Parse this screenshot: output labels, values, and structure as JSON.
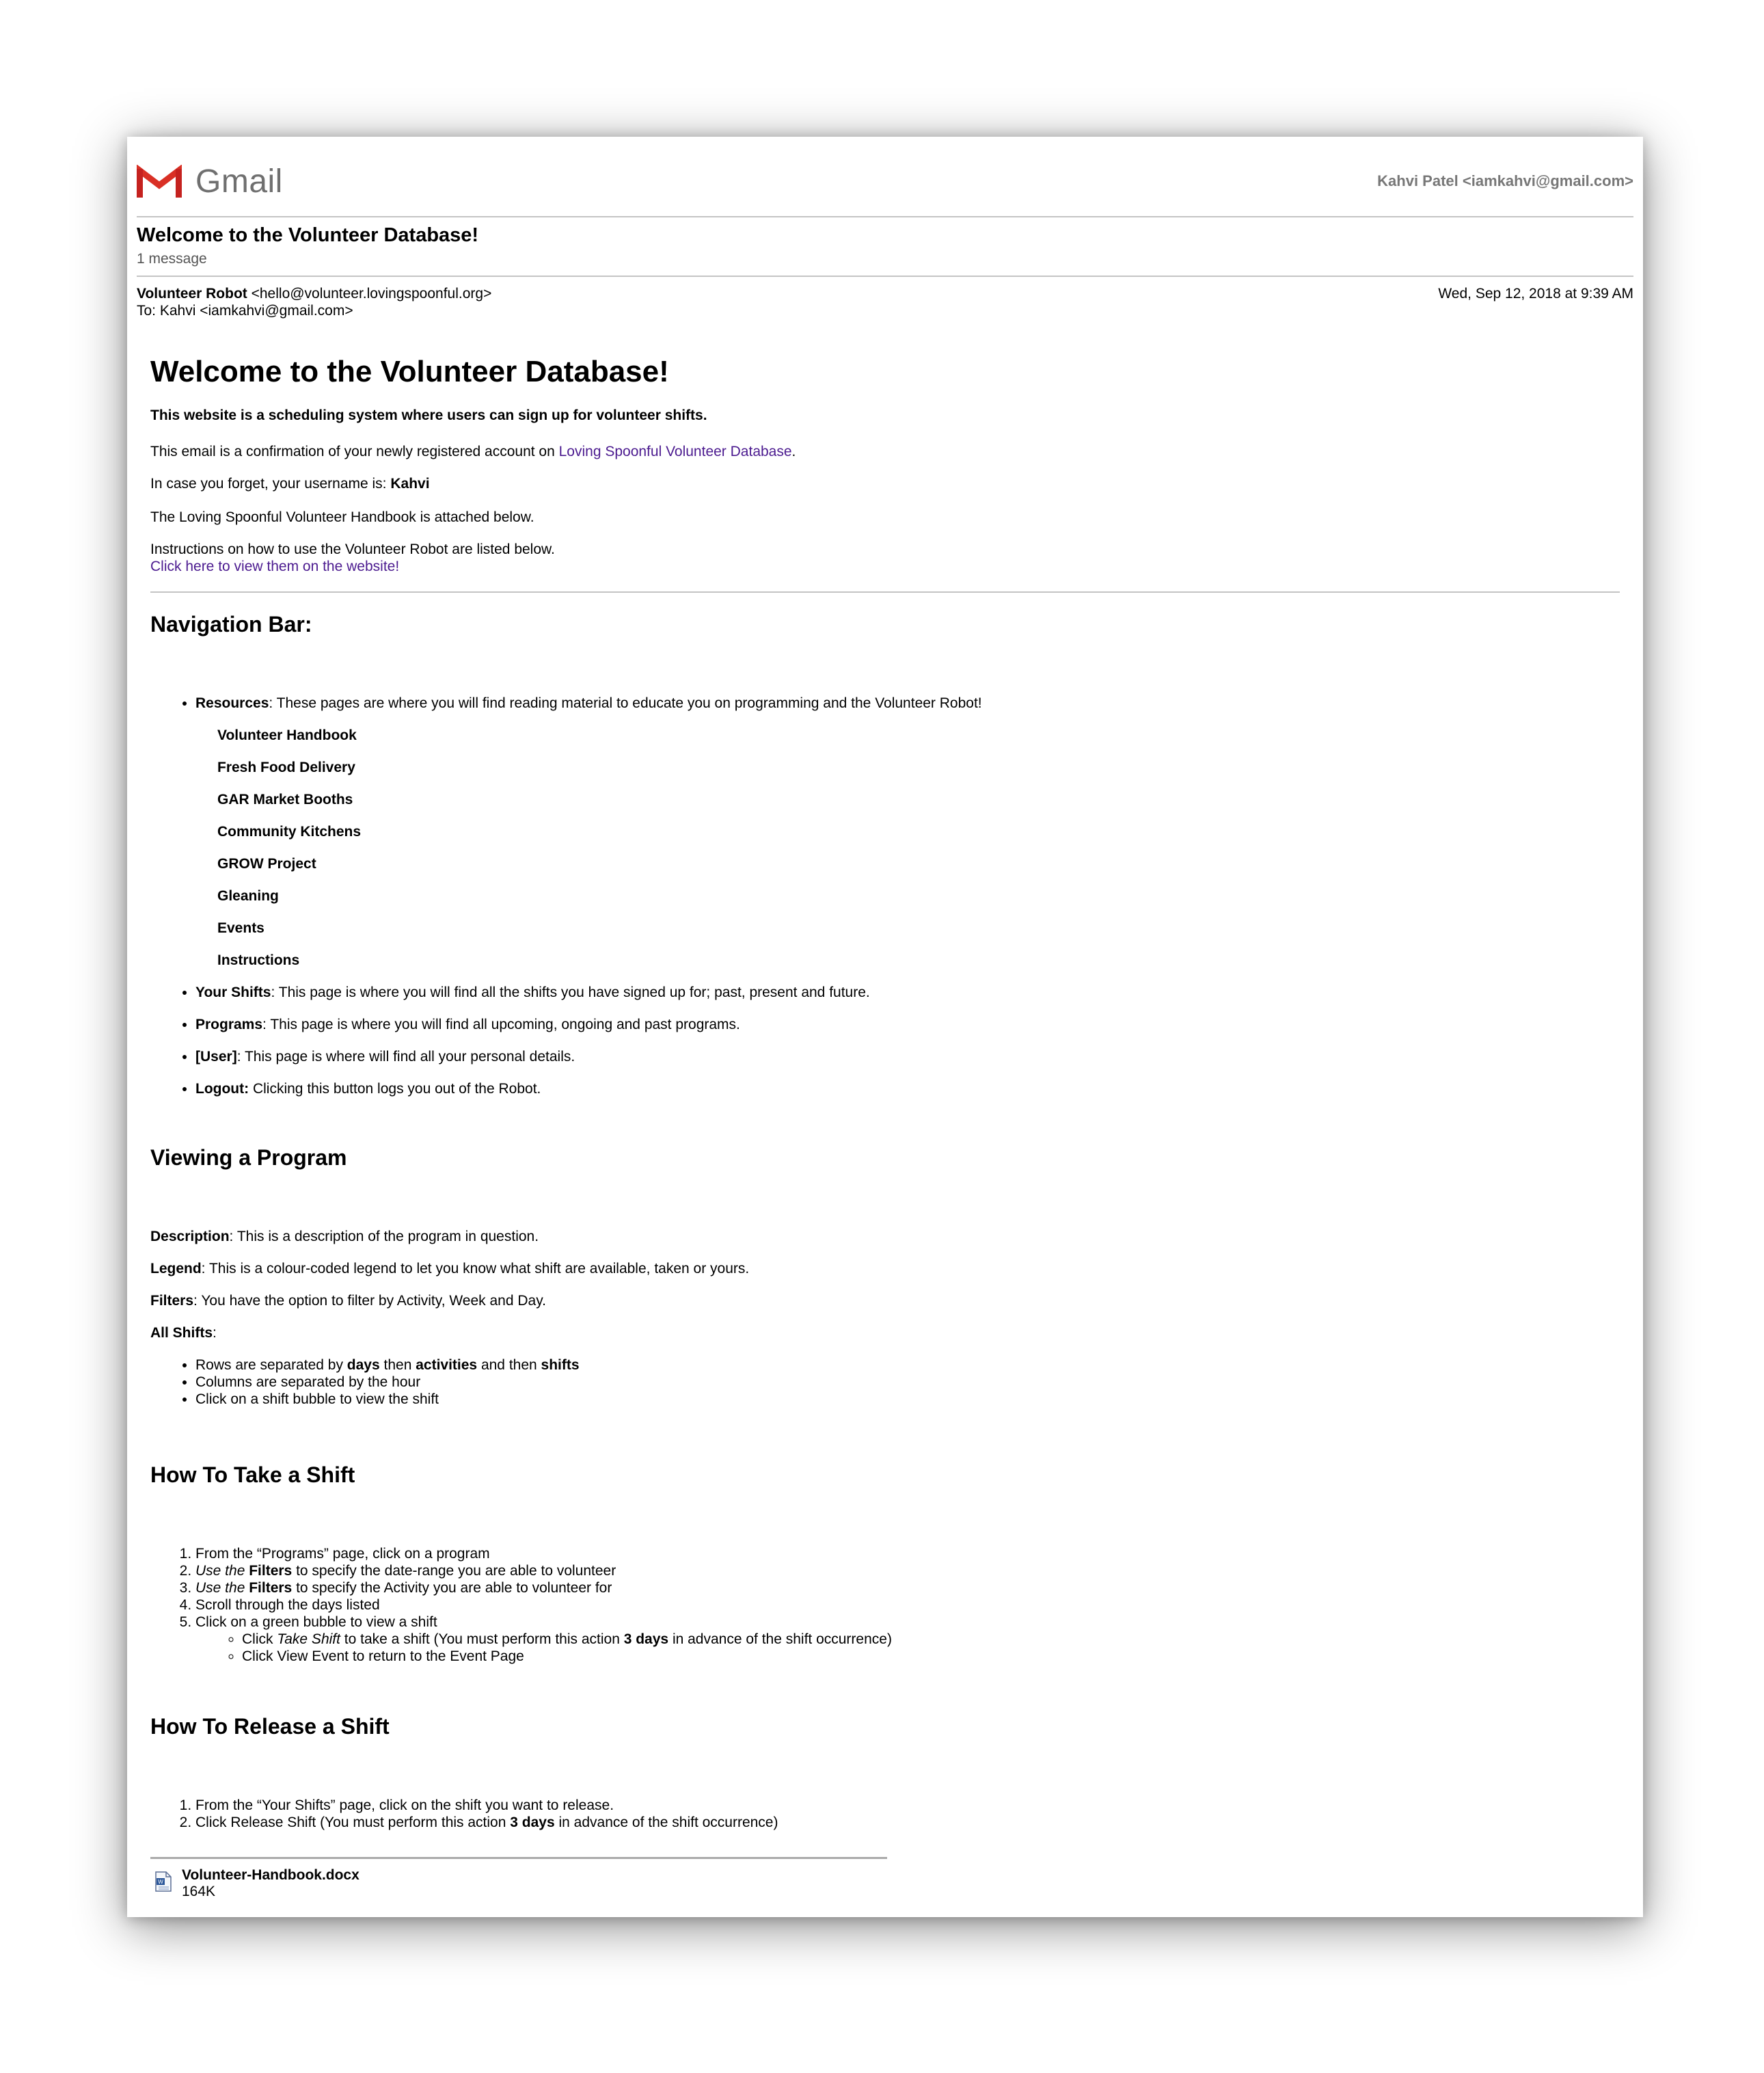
{
  "header": {
    "brand": "Gmail",
    "account": "Kahvi Patel <iamkahvi@gmail.com>"
  },
  "thread": {
    "subject": "Welcome to the Volunteer Database!",
    "count": "1 message"
  },
  "message": {
    "from_name": "Volunteer Robot",
    "from_email": "<hello@volunteer.lovingspoonful.org>",
    "to": "To: Kahvi <iamkahvi@gmail.com>",
    "date": "Wed, Sep 12, 2018 at 9:39 AM"
  },
  "email": {
    "title": "Welcome to the Volunteer Database!",
    "intro": "This website is a scheduling system where users can sign up for volunteer shifts.",
    "confirm_prefix": "This email is a confirmation of your newly registered account on ",
    "confirm_link": "Loving Spoonful Volunteer Database",
    "confirm_suffix": ".",
    "username_prefix": "In case you forget, your username is: ",
    "username": "Kahvi",
    "handbook_line": "The Loving Spoonful Volunteer Handbook is attached below.",
    "instructions_line": "Instructions on how to use the Volunteer Robot are listed below.",
    "instructions_link": "Click here to view them on the website!"
  },
  "navigation": {
    "heading": "Navigation Bar:",
    "resources_label": "Resources",
    "resources_text": ": These pages are where you will find reading material to educate you on programming and the Volunteer Robot!",
    "resources_items": [
      "Volunteer Handbook",
      "Fresh Food Delivery",
      "GAR Market Booths",
      "Community Kitchens",
      "GROW Project",
      "Gleaning",
      "Events",
      "Instructions"
    ],
    "items": [
      {
        "label": "Your Shifts",
        "text": ": This page is where you will find all the shifts you have signed up for; past, present and future."
      },
      {
        "label": "Programs",
        "text": ": This page is where you will find all upcoming, ongoing and past programs."
      },
      {
        "label": "[User]",
        "text": ": This page is where will find all your personal details."
      },
      {
        "label": "Logout:",
        "text": " Clicking this button logs you out of the Robot."
      }
    ]
  },
  "viewing": {
    "heading": "Viewing a Program",
    "description_label": "Description",
    "description_text": ": This is a description of the program in question.",
    "legend_label": "Legend",
    "legend_text": ": This is a colour-coded legend to let you know what shift are available, taken or yours.",
    "filters_label": "Filters",
    "filters_text": ": You have the option to filter by Activity, Week and Day.",
    "allshifts_label": "All Shifts",
    "allshifts_suffix": ":",
    "row_a": "Rows are separated by ",
    "row_b": "days",
    "row_c": " then ",
    "row_d": "activities",
    "row_e": " and then ",
    "row_f": "shifts",
    "columns": "Columns are separated by the hour",
    "click": "Click on a shift bubble to view the shift"
  },
  "take": {
    "heading": "How To Take a Shift",
    "step1": "From the “Programs” page, click on a program",
    "use_the": "Use the",
    "filters": "Filters",
    "step2_rest": " to specify the date-range you are able to volunteer",
    "step3_rest": " to specify the Activity you are able to volunteer for",
    "step4": "Scroll through the days listed",
    "step5": "Click on a green bubble to view a shift",
    "sub1_a": "Click ",
    "sub1_b": "Take Shift",
    "sub1_c": " to take a shift (You must perform this action ",
    "sub1_d": "3 days",
    "sub1_e": " in advance of the shift occurrence)",
    "sub2": "Click View Event to return to the Event Page"
  },
  "release": {
    "heading": "How To Release a Shift",
    "step1": "From the “Your Shifts” page, click on the shift you want to release.",
    "step2_a": "Click Release Shift (You must perform this action ",
    "step2_b": "3 days",
    "step2_c": " in advance of the shift occurrence)"
  },
  "attachment": {
    "name": "Volunteer-Handbook.docx",
    "size": "164K"
  }
}
